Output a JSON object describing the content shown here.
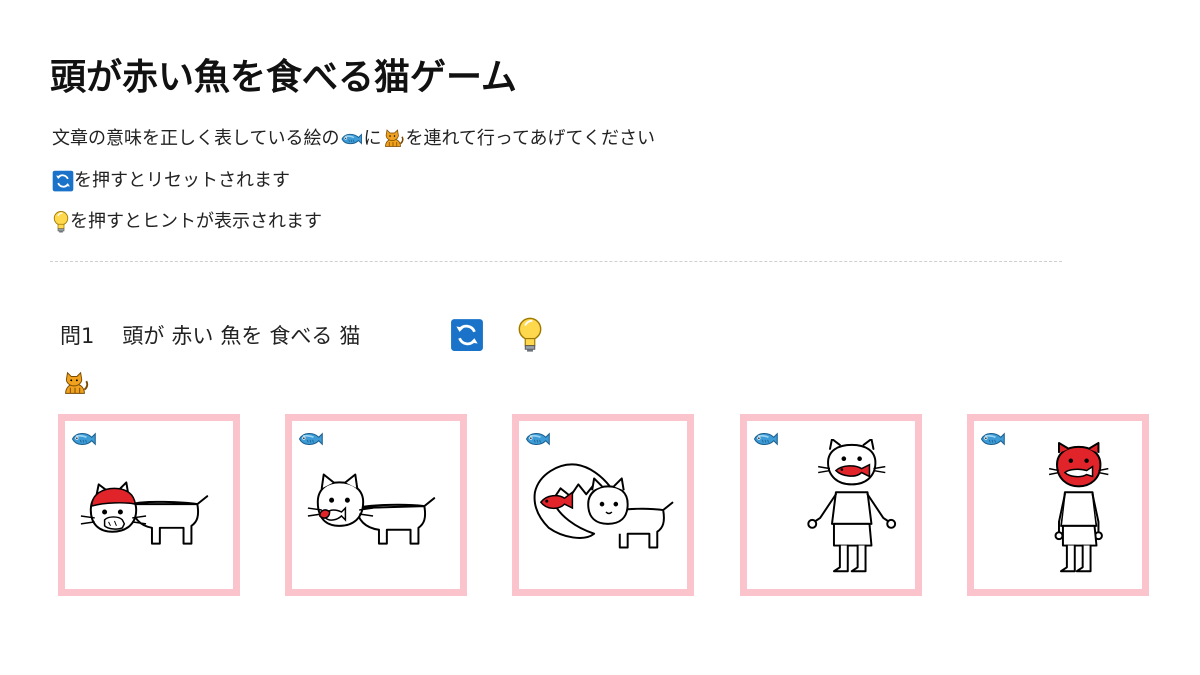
{
  "page": {
    "title": "頭が赤い魚を食べる猫ゲーム"
  },
  "instructions": {
    "line1_part1": "文章の意味を正しく表している絵の",
    "line1_part2": "に",
    "line1_part3": "を連れて行ってあげてください",
    "line2": "を押すとリセットされます",
    "line3": "を押すとヒントが表示されます"
  },
  "question": {
    "number": "問1",
    "words": [
      "頭が",
      "赤い",
      "魚を",
      "食べる",
      "猫"
    ]
  },
  "icons": {
    "fish": "fish-icon",
    "cat": "cat-icon",
    "reset": "reset-icon",
    "hint": "lightbulb-icon"
  },
  "cards": [
    {
      "id": 1,
      "scene": "red-headed cat eating a white fish"
    },
    {
      "id": 2,
      "scene": "white cat eating a red-headed fish"
    },
    {
      "id": 3,
      "scene": "fish with red head biting a cat"
    },
    {
      "id": 4,
      "scene": "standing cat eating a red fish"
    },
    {
      "id": 5,
      "scene": "standing red-headed cat eating a fish"
    }
  ],
  "colors": {
    "card_border": "#fbc4cc",
    "red": "#e0242a",
    "reset_blue": "#1a73c9",
    "fish_blue": "#3d9bd6",
    "cat_orange": "#f0a21e",
    "bulb_yellow": "#ffd84d"
  }
}
